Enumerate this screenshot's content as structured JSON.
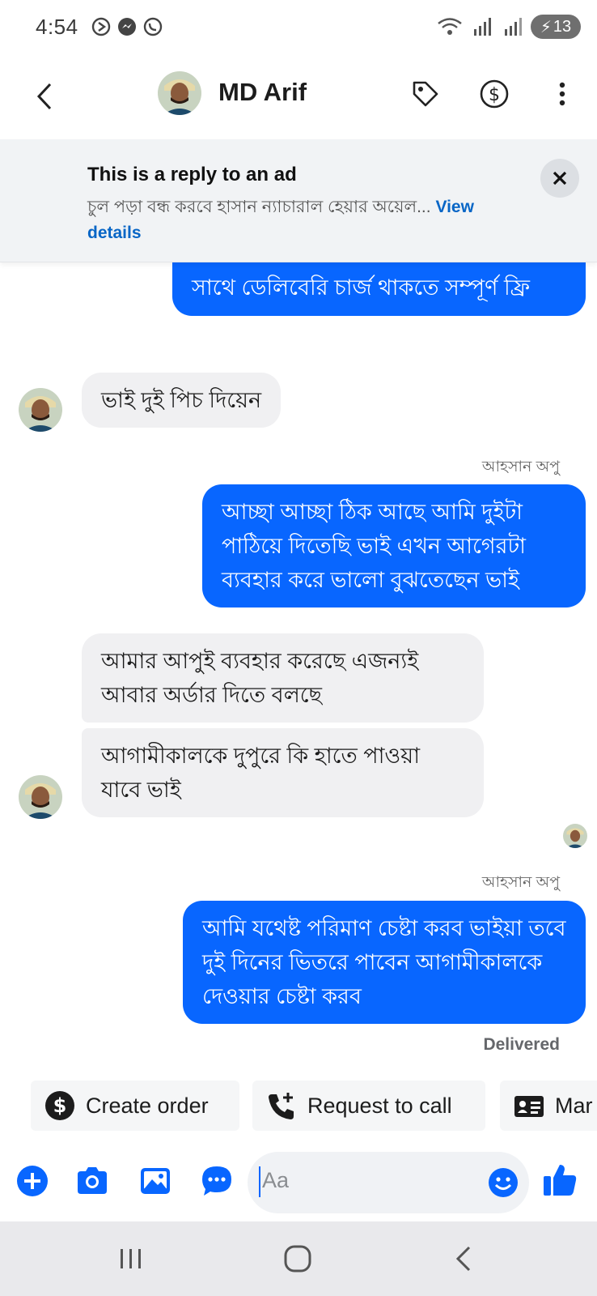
{
  "status_bar": {
    "time": "4:54",
    "battery": "13"
  },
  "header": {
    "contact_name": "MD Arif"
  },
  "ad_banner": {
    "title": "This is a reply to an ad",
    "description": "চুল পড়া বন্ধ করবে হাসান ন্যাচারাল  হেয়ার অয়েল...",
    "link_text": "View details"
  },
  "messages": [
    {
      "direction": "outgoing",
      "text": "সাথে ডেলিবেরি চার্জ  থাকতে সম্পূর্ণ ফ্রি"
    },
    {
      "direction": "incoming",
      "text": "ভাই দুই পিচ দিয়েন"
    },
    {
      "direction": "outgoing",
      "sender": "আহসান অপু",
      "text": "আচ্ছা আচ্ছা ঠিক আছে আমি দুইটা পাঠিয়ে দিতেছি ভাই এখন আগেরটা ব্যবহার করে ভালো বুঝতেছেন ভাই"
    },
    {
      "direction": "incoming",
      "text": "আমার আপুই ব্যবহার করেছে এজন্যই আবার অর্ডার দিতে বলছে"
    },
    {
      "direction": "incoming",
      "text": "আগামীকালকে দুপুরে কি হাতে পাওয়া যাবে ভাই"
    },
    {
      "direction": "outgoing",
      "sender": "আহসান অপু",
      "text": "আমি যথেষ্ট পরিমাণ চেষ্টা করব ভাইয়া তবে দুই দিনের ভিতরে পাবেন আগামীকালকে দেওয়ার চেষ্টা করব"
    }
  ],
  "delivery_status": "Delivered",
  "quick_actions": [
    {
      "label": "Create order",
      "icon": "dollar-circle-icon"
    },
    {
      "label": "Request to call",
      "icon": "phone-plus-icon"
    },
    {
      "label": "Mar",
      "icon": "contact-card-icon"
    }
  ],
  "composer": {
    "placeholder": "Aa"
  },
  "colors": {
    "accent": "#0866ff",
    "incoming_bubble": "#f0f0f2",
    "link": "#0866c6"
  }
}
